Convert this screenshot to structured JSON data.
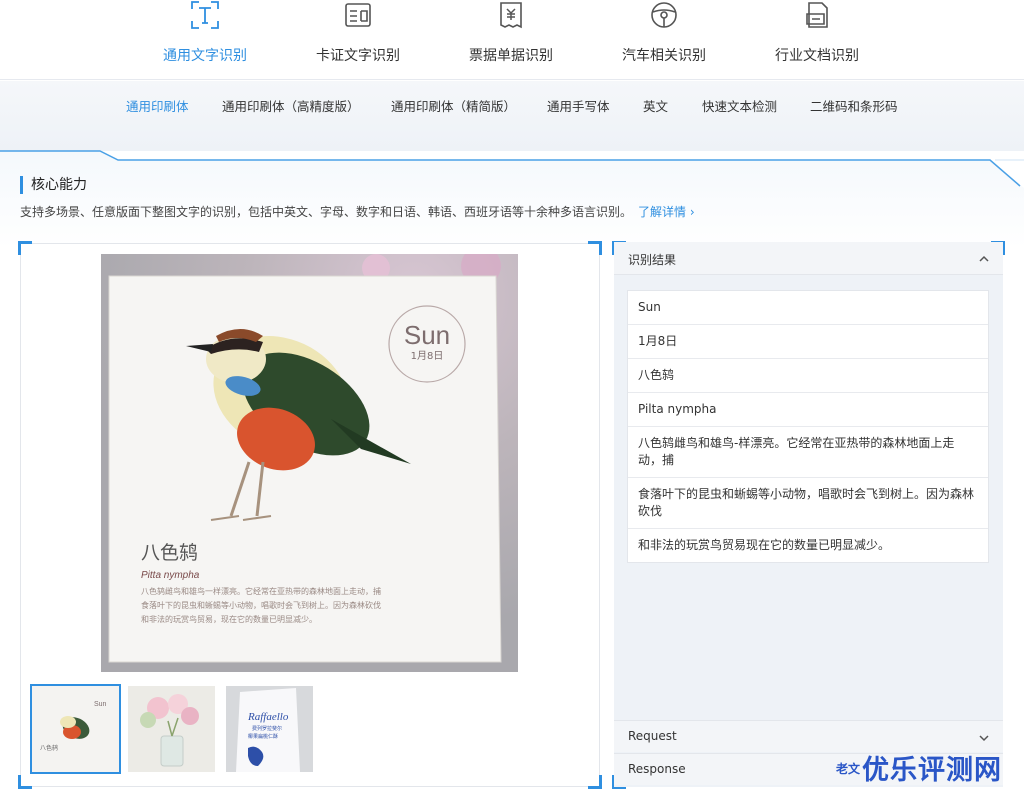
{
  "categories": [
    {
      "label": "通用文字识别",
      "icon": "text-recognition-icon",
      "active": true
    },
    {
      "label": "卡证文字识别",
      "icon": "id-card-icon",
      "active": false
    },
    {
      "label": "票据单据识别",
      "icon": "receipt-icon",
      "active": false
    },
    {
      "label": "汽车相关识别",
      "icon": "steering-wheel-icon",
      "active": false
    },
    {
      "label": "行业文档识别",
      "icon": "document-icon",
      "active": false
    }
  ],
  "subtabs": [
    {
      "label": "通用印刷体",
      "active": true
    },
    {
      "label": "通用印刷体（高精度版）"
    },
    {
      "label": "通用印刷体（精简版）"
    },
    {
      "label": "通用手写体"
    },
    {
      "label": "英文"
    },
    {
      "label": "快速文本检测"
    },
    {
      "label": "二维码和条形码"
    }
  ],
  "ability": {
    "title": "核心能力",
    "description": "支持多场景、任意版面下整图文字的识别，包括中英文、字母、数字和日语、韩语、西班牙语等十余种多语言识别。",
    "link": "了解详情"
  },
  "card": {
    "day": "Sun",
    "date": "1月8日",
    "name_cn": "八色鸫",
    "name_latin": "Pitta nympha",
    "body_line1": "八色鸫雌鸟和雄鸟一样漂亮。它经常在亚热带的森林地面上走动，捕",
    "body_line2": "食落叶下的昆虫和蜥蜴等小动物，唱歌时会飞到树上。因为森林砍伐",
    "body_line3": "和非法的玩赏鸟贸易，现在它的数量已明显减少。"
  },
  "thumbnails": [
    {
      "name": "bird-calendar",
      "selected": true,
      "label_day": "Sun",
      "label_cn": "八色鸫"
    },
    {
      "name": "flowers-vase",
      "selected": false
    },
    {
      "name": "raffaello-box",
      "selected": false,
      "brand": "Raffaello",
      "line1": "费列罗拉斐尔",
      "line2": "椰果扁桃仁酥"
    }
  ],
  "result": {
    "header": "识别结果",
    "rows": [
      "Sun",
      "1月8日",
      "八色鸫",
      "Pilta nympha",
      "八色鸫雌鸟和雄鸟-样漂亮。它经常在亚热带的森林地面上走动，捕",
      "食落叶下的昆虫和蜥蜴等小动物，唱歌时会飞到树上。因为森林砍伐",
      "和非法的玩赏鸟贸易现在它的数量已明显减少。"
    ],
    "request_label": "Request",
    "response_label": "Response"
  },
  "old_link": "老文",
  "watermark": "优乐评测网",
  "colors": {
    "accent": "#2f8fe0",
    "watermark": "#2a56c7"
  }
}
